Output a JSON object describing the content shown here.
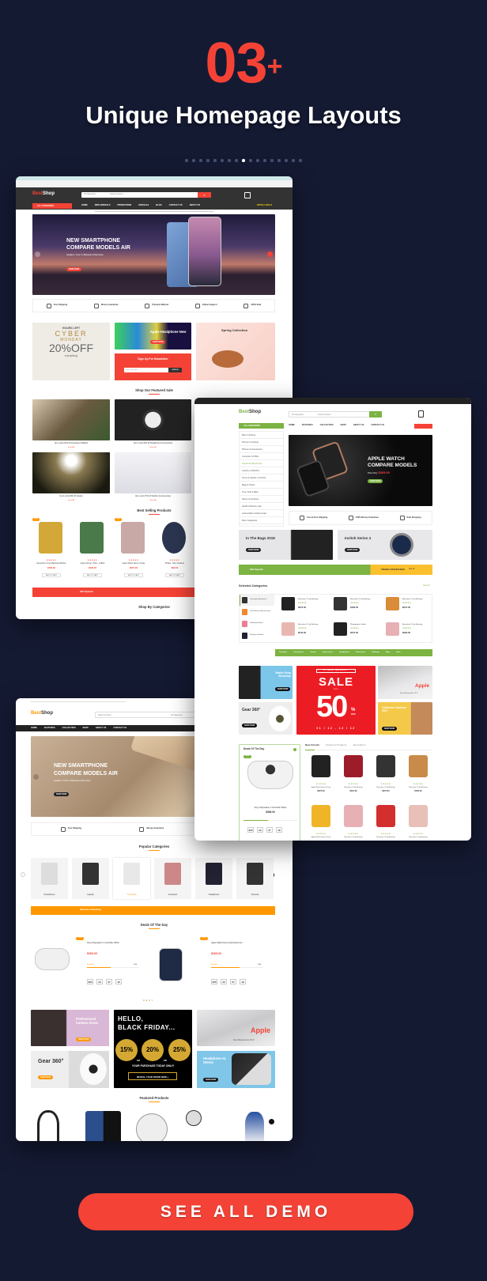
{
  "hero": {
    "count": "03",
    "plus": "+",
    "title": "Unique Homepage Layouts",
    "dots_total": 17,
    "dots_active_index": 8
  },
  "colors": {
    "background": "#151a33",
    "accent": "#f44336",
    "layout2_green": "#7cb342",
    "layout3_orange": "#ff9800",
    "trade_yellow": "#fbc02d"
  },
  "layout1": {
    "logo": {
      "best": "Best",
      "shop": "Shop"
    },
    "all_categories": "ALL CATEGORIES",
    "nav": [
      "HOME",
      "NEW ARRIVALS",
      "PROMOTIONS",
      "SPECIALS",
      "BLOG",
      "CONTACT US",
      "ABOUT US"
    ],
    "special": "SPECIAL DEALS",
    "search_placeholder": "Search product...",
    "category_select": "All Categories",
    "banner": {
      "line1": "NEW SMARTPHONE",
      "line2": "COMPARE MODELS AIR",
      "sub": "Awaken Your In-Between Moments",
      "button": "SHOP NOW"
    },
    "features": [
      "Free Shipping",
      "Money Guarantee",
      "Payment Method",
      "Online Support",
      "100% Safe"
    ],
    "cyber": {
      "hours": "HOURS LEFT",
      "cyber": "CYBER",
      "monday": "MONDAY",
      "pct": "20%",
      "off": "OFF",
      "everything": "everything"
    },
    "headphone": {
      "title": "Apple Headphone New",
      "button": "SHOP NOW"
    },
    "newsletter": {
      "title": "Sign Up For Newsletter",
      "placeholder": "Enter Your Mail",
      "button": "SIGN IN"
    },
    "spring": {
      "title": "Spring Collection"
    },
    "featured_title": "Shop Our Featured Sale",
    "featured": [
      {
        "caption": "Up to extra 10% off Computers &Tablets",
        "link": "Show All"
      },
      {
        "caption": "Up to extra 30% off Headphone & Accessories",
        "link": "Show All"
      },
      {
        "caption": "Up to extra 20% off Jewelry",
        "link": "Show All"
      },
      {
        "caption": "Up to extra 70% off Fashion & Accessories",
        "link": "Show All"
      }
    ],
    "best_title": "Best Selling Products",
    "products": [
      {
        "name": "Electrolux 2.3 kg Washing Machine",
        "price": "$790.00",
        "badge": "NEW",
        "color": "#d4a838"
      },
      {
        "name": "Apple Iphone 7 Plus - 128Gb",
        "price": "$100.00",
        "badge": "",
        "color": "#4a7a4a"
      },
      {
        "name": "Apple Watch Series 3 Gray",
        "price": "$270.00",
        "badge": "NEW",
        "color": "#c9a9a6"
      },
      {
        "name": "Philips - Nice Cordless",
        "price": "$90.00",
        "badge": "",
        "color": "#2c3550"
      }
    ],
    "add_to_cart": "ADD TO CART",
    "gift": {
      "label": "Gift Special"
    },
    "categories_title": "Shop By Categories"
  },
  "layout2": {
    "logo": {
      "best": "Best",
      "shop": "Shop"
    },
    "all_categories": "ALL CATEGORIES",
    "search_placeholder": "Search product...",
    "category_select": "All Categories",
    "nav": [
      "HOME",
      "FEATURES",
      "COLLECTION",
      "SHOP",
      "ABOUT US",
      "CONTACT US"
    ],
    "sidebar": [
      "Men's Clothing",
      "Women's Clothing",
      "Phones & Accessories",
      "Computer & Office",
      "Consumer Electronics",
      "Jewelry & Watches",
      "Home & Garden, Furniture",
      "Bags & Shoes",
      "Toys, Kids & Baby",
      "Sports & Outdoors",
      "Health & Beauty, Hair",
      "Automobiles & Motorcycles",
      "More Categories"
    ],
    "banner": {
      "line1": "APPLE WATCH",
      "line2": "COMPARE MODELS",
      "price_label": "Price Only:",
      "price": "$369.00",
      "button": "SHOP NOW"
    },
    "features": [
      "Fast & Free Shipping",
      "100% Money Guarantee",
      "Safe Shopping"
    ],
    "promo": [
      {
        "title": "In The Bags 2018",
        "button": "SHOP NOW"
      },
      {
        "title": "Invitsh Series 4",
        "button": "SHOP NOW"
      }
    ],
    "gift": {
      "label": "Gift Special",
      "trade": "TRADE ASSURANCE",
      "more": "See all"
    },
    "selected_title": "Selected Categories",
    "view_all": "View All",
    "cat_list": [
      "Consumer Electronics",
      "Cell Phones & Accessories",
      "Fashioned Shoes",
      "Furniture & Home"
    ],
    "cat_products": [
      {
        "name": "Electrolux 2.3 kg Washing",
        "price": "$270.00",
        "color": "#222"
      },
      {
        "name": "Electrolux 2.3 kg Washing",
        "price": "$180.00",
        "color": "#333"
      },
      {
        "name": "Electrolux 2.3 kg Washing",
        "price": "$270.00",
        "color": "#d98c3a"
      },
      {
        "name": "Electrolux 2.3 kg Washing",
        "price": "$540.00",
        "color": "#e8b8b0"
      },
      {
        "name": "Photographic Studio",
        "price": "$270.00",
        "color": "#222"
      },
      {
        "name": "Electrolux 2.3 kg Washing",
        "price": "$299.00",
        "color": "#e6b0b5"
      }
    ],
    "cat_tabs": [
      "Computer",
      "Smartphone",
      "Camera",
      "Accessories",
      "Headphones",
      "Electronics",
      "Clothings",
      "Bags",
      "More"
    ],
    "banners": {
      "watch": "Watch Shop Bestshop",
      "gear": "Gear 360°",
      "cyber": "CYBER MONDAY",
      "sale": "SALE",
      "upto": "UP TO",
      "fifty": "50",
      "pct": "%",
      "off": "OFF",
      "dates": "01 / 12 - 12 / 12",
      "apple": "Apple",
      "macbook": "New Macbook Air 13.3\"",
      "collection": "Collection Summer 2017",
      "button": "SHOP NOW"
    },
    "deals": {
      "title": "Deals Of The Day",
      "badge": "NEW",
      "name": "Sony Playstation 4 Controller White",
      "price": "$369.00",
      "countdown": [
        "365",
        "23",
        "07",
        "49"
      ]
    },
    "tabs": [
      "New Arrivals",
      "Featured Products",
      "Bestsellers"
    ],
    "arrivals": [
      {
        "name": "Apple Watch Series 3 Gray",
        "price": "$270.00",
        "color": "#222"
      },
      {
        "name": "Electrolux 2.3 kg Washing",
        "price": "$110.00",
        "color": "#9c1c2a"
      },
      {
        "name": "Electrolux 2.3 kg Washing",
        "price": "$270.00",
        "color": "#333"
      },
      {
        "name": "Electrolux 2.3 kg Washing",
        "price": "$790.00",
        "color": "#c88b4a"
      },
      {
        "name": "Apple Watch Series 3 Gray",
        "price": "",
        "color": "#f0b429"
      },
      {
        "name": "Electrolux 2.3 kg Washing",
        "price": "",
        "color": "#e6b0b5"
      },
      {
        "name": "Electrolux 2.3 kg Washing",
        "price": "",
        "color": "#d32f2f"
      },
      {
        "name": "Electrolux 2.3 kg Washing",
        "price": "",
        "color": "#e8c0b8"
      }
    ]
  },
  "layout3": {
    "logo": {
      "best": "Best",
      "shop": "Shop"
    },
    "search_placeholder": "Search product...",
    "category_select": "All Categories",
    "nav": [
      "HOME",
      "FEATURES",
      "COLLECTION",
      "SHOP",
      "ABOUT US",
      "CONTACT US"
    ],
    "banner": {
      "line1": "NEW SMARTPHONE",
      "line2": "COMPARE MODELS AIR",
      "sub": "Awaken Your In-Between Moments",
      "button": "SHOP NOW"
    },
    "features": [
      "Free Shipping",
      "Money Guarantee",
      "Payment Method"
    ],
    "popular_title": "Popular Categories",
    "popular": [
      "Smartphones",
      "Laptops",
      "TV & Audio",
      "Computers",
      "Headphones",
      "Cameras"
    ],
    "popular_active_index": 2,
    "welcome": "Welcome to Bestshop",
    "deals_title": "Deals Of The Day",
    "deals": [
      {
        "name": "Sony Playstation 4 Controller White",
        "price": "$369.00",
        "available": "Available:",
        "sold": "Sold:",
        "progress": 0.45,
        "countdown": [
          "365",
          "23",
          "07",
          "49"
        ]
      },
      {
        "name": "Apple Watch Nove Gold Aluminum",
        "price": "$369.00",
        "available": "Available:",
        "sold": "Sold:",
        "progress": 0.55,
        "countdown": [
          "365",
          "23",
          "07",
          "49"
        ]
      }
    ],
    "banners": {
      "camera": "Professional Camera Zoom",
      "gear": "Gear 360°",
      "hello": "HELLO,",
      "bf": "BLACK FRIDAY...",
      "p15": "15%",
      "p20": "20%",
      "p25": "25%",
      "or": "OR",
      "today": "YOUR PURCHASE TODAY ONLY!",
      "reveal": "REVEAL YOUR OFFER NOW »",
      "apple": "Apple",
      "macbook": "New Macbook Air 15.6\"",
      "headphone": "Headphone XL Stereo",
      "button": "SHOP NOW"
    },
    "featured_title": "Featured Products"
  },
  "cta": {
    "label": "SEE ALL DEMO"
  }
}
